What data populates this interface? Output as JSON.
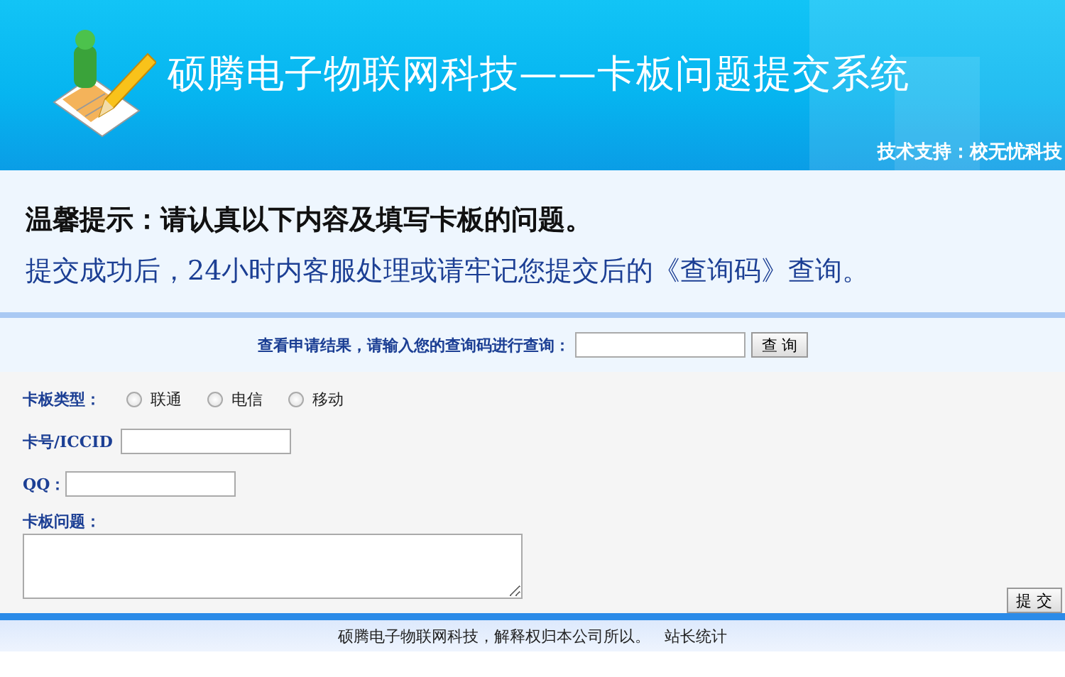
{
  "header": {
    "title": "硕腾电子物联网科技——卡板问题提交系统",
    "support": "技术支持：校无忧科技"
  },
  "notice": {
    "line_1": "温馨提示：请认真以下内容及填写卡板的问题。",
    "line_2": "提交成功后，24小时内客服处理或请牢记您提交后的《查询码》查询。"
  },
  "query": {
    "label": "查看申请结果，请输入您的查询码进行查询：",
    "button": "查 询"
  },
  "form": {
    "type_label": "卡板类型：",
    "options": [
      {
        "label": "联通",
        "selected": false
      },
      {
        "label": "电信",
        "selected": false
      },
      {
        "label": "移动",
        "selected": false
      }
    ],
    "iccid_label": "卡号/ICCID",
    "qq_label": "QQ：",
    "problem_label": "卡板问题：",
    "submit": "提 交"
  },
  "footer": {
    "text": "硕腾电子物联网科技，解释权归本公司所以。",
    "link": "站长统计"
  }
}
